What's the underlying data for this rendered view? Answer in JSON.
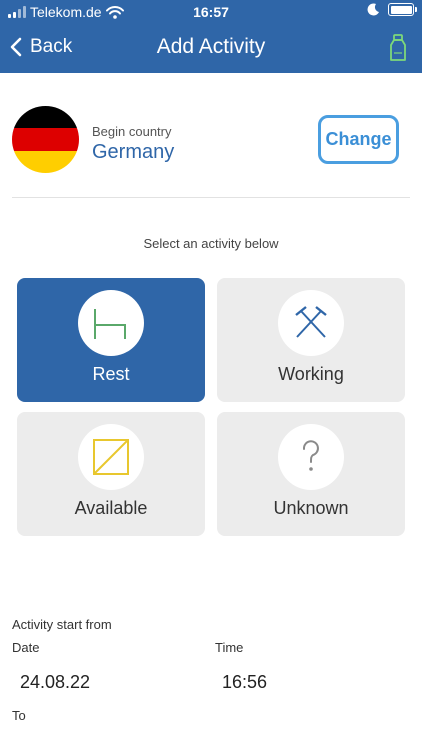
{
  "status_bar": {
    "carrier": "Telekom.de",
    "time": "16:57"
  },
  "nav": {
    "back_label": "Back",
    "title": "Add Activity",
    "right_icon": "bottle-icon",
    "right_icon_color": "#7dd87a"
  },
  "begin_country": {
    "label": "Begin country",
    "name": "Germany",
    "flag_colors": [
      "#000000",
      "#dd0000",
      "#ffce00"
    ],
    "change_label": "Change"
  },
  "select_prompt": "Select an activity below",
  "activities": [
    {
      "label": "Rest",
      "icon": "bed-icon",
      "icon_color": "#5aa86a",
      "selected": true
    },
    {
      "label": "Working",
      "icon": "crossed-hammers-icon",
      "icon_color": "#2f66a8",
      "selected": false
    },
    {
      "label": "Available",
      "icon": "available-box-icon",
      "icon_color": "#e8c72e",
      "selected": false
    },
    {
      "label": "Unknown",
      "icon": "question-mark-icon",
      "icon_color": "#8a8a8a",
      "selected": false
    }
  ],
  "activity_start": {
    "heading": "Activity start from",
    "date_label": "Date",
    "date_value": "24.08.22",
    "time_label": "Time",
    "time_value": "16:56"
  },
  "to_label": "To",
  "colors": {
    "primary": "#2f66a8",
    "accent_border": "#4a9ee0",
    "tile_bg": "#ececec"
  }
}
